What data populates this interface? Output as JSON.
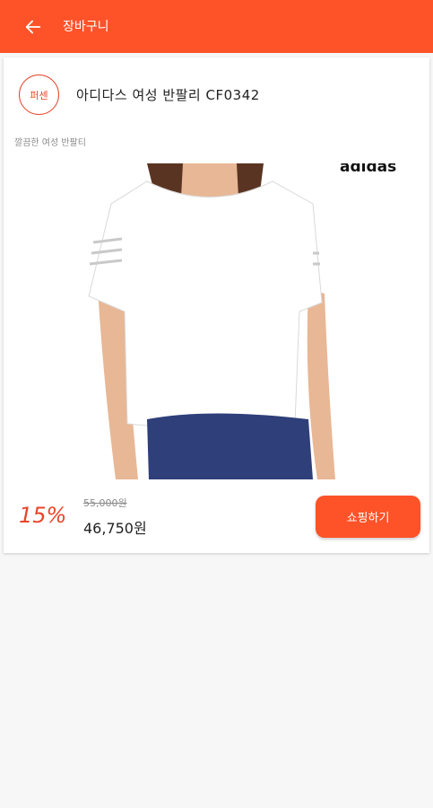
{
  "appbar": {
    "title": "장바구니",
    "back_icon": "arrow-left-icon"
  },
  "product": {
    "brand_badge": "퍼센",
    "name": "아디다스 여성 반팔리 CF0342",
    "description": "깔끔한 여성 반팔티",
    "image_logo_text": "adidas",
    "discount": "15%",
    "original_price": "55,000원",
    "sale_price": "46,750원",
    "shop_button": "쇼핑하기"
  },
  "colors": {
    "accent": "#fe5228",
    "badge": "#e7452a",
    "shirt": "#ffffff",
    "skirt": "#2f3f7a",
    "hair": "#5a3422",
    "skin": "#e8b795"
  }
}
